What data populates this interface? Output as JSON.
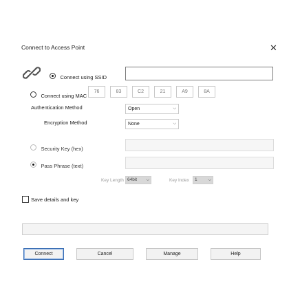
{
  "dialog": {
    "title": "Connect to Access Point",
    "close_glyph": "✕"
  },
  "ssid": {
    "radio_label": "Connect using SSID",
    "value": ""
  },
  "mac": {
    "radio_label": "Connect using MAC",
    "octets": [
      "76",
      "83",
      "C2",
      "21",
      "A9",
      "8A"
    ]
  },
  "authentication": {
    "label": "Authentication Method",
    "value": "Open"
  },
  "encryption": {
    "label": "Encryption Method",
    "value": "None"
  },
  "security_key": {
    "radio_label": "Security Key (hex)"
  },
  "pass_phrase": {
    "radio_label": "Pass Phrase (text)"
  },
  "key_length": {
    "label": "Key Length",
    "value": "64bit"
  },
  "key_index": {
    "label": "Key Index",
    "value": "1"
  },
  "save_details": {
    "label": "Save details and key"
  },
  "buttons": {
    "connect": "Connect",
    "cancel": "Cancel",
    "manage": "Manage",
    "help": "Help"
  },
  "icons": {
    "link": "link-icon",
    "close": "close-icon",
    "dropdown": "chevron-down-icon"
  },
  "colors": {
    "primary_button_border": "#3b6fb5"
  }
}
